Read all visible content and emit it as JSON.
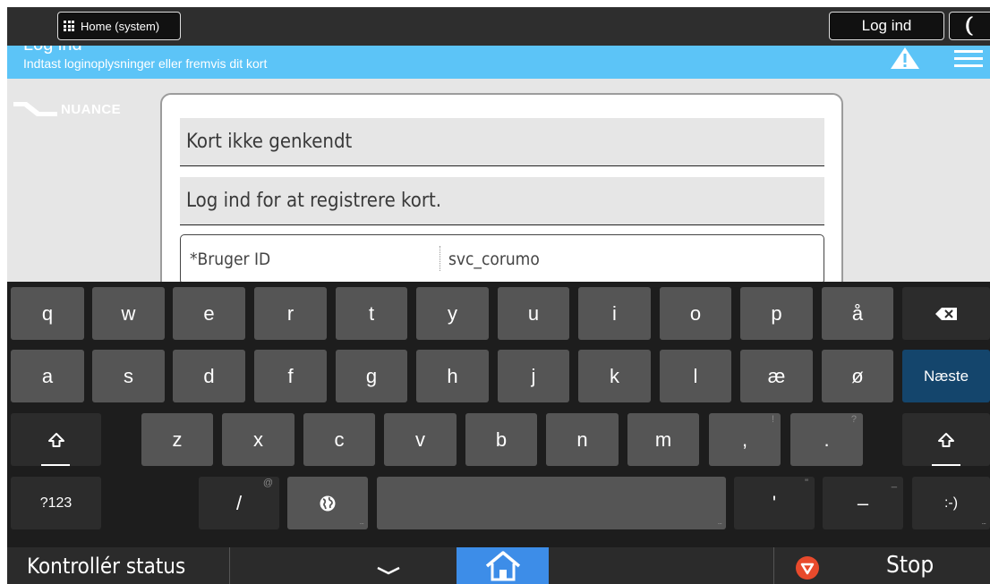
{
  "topbar": {
    "home_label": "Home (system)",
    "login_label": "Log ind"
  },
  "header": {
    "title": "Log ind",
    "subtitle": "Indtast loginoplysninger eller fremvis dit kort"
  },
  "logo": {
    "text": "NUANCE"
  },
  "panel": {
    "message1": "Kort ikke genkendt",
    "message2": "Log ind for at registrere kort.",
    "field_label": "*Bruger ID",
    "field_value": "svc_corumo"
  },
  "keyboard": {
    "row1": [
      "q",
      "w",
      "e",
      "r",
      "t",
      "y",
      "u",
      "i",
      "o",
      "p",
      "å"
    ],
    "row2": [
      "a",
      "s",
      "d",
      "f",
      "g",
      "h",
      "j",
      "k",
      "l",
      "æ",
      "ø"
    ],
    "row3": [
      "z",
      "x",
      "c",
      "v",
      "b",
      "n",
      "m",
      ",",
      "."
    ],
    "row3_hints": [
      "!",
      "?"
    ],
    "next_label": "Næste",
    "sym_label": "?123",
    "slash": "/",
    "slash_hint": "@",
    "apostrophe": "'",
    "apostrophe_hint": "\"",
    "dash": "–",
    "dash_hint": "_",
    "smiley": ":-)"
  },
  "bottom": {
    "status_label": "Kontrollér status",
    "stop_label": "Stop"
  },
  "colors": {
    "header_blue": "#5cc4f7",
    "home_blue": "#3d8de8",
    "next_blue": "#14456c",
    "stop_red": "#e84a2c"
  },
  "icons": {
    "grid": "grid-icon",
    "moon": "moon-icon",
    "warning": "warning-icon",
    "menu": "hamburger-icon",
    "backspace": "backspace-icon",
    "shift": "shift-icon",
    "globe": "globe-icon",
    "chevron": "chevron-down-icon",
    "home": "home-icon",
    "stop": "stop-icon"
  }
}
